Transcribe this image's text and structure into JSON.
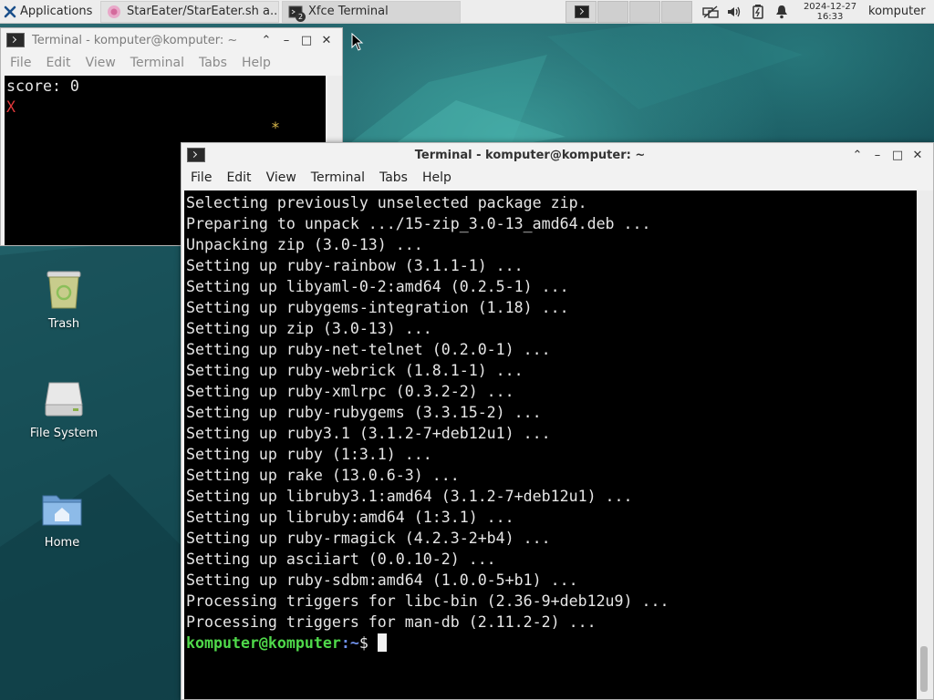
{
  "panel": {
    "applications_label": "Applications",
    "tasks": [
      {
        "label": "StarEater/StarEater.sh a..."
      },
      {
        "label": "Xfce Terminal",
        "badge": "2"
      }
    ],
    "clock_date": "2024-12-27",
    "clock_time": "16:33",
    "user": "komputer"
  },
  "window_back": {
    "title": "Terminal - komputer@komputer: ~",
    "menu": [
      "File",
      "Edit",
      "View",
      "Terminal",
      "Tabs",
      "Help"
    ],
    "score_line": "score: 0",
    "player_char": "X",
    "star_char": "*"
  },
  "window_front": {
    "title": "Terminal - komputer@komputer: ~",
    "menu": [
      "File",
      "Edit",
      "View",
      "Terminal",
      "Tabs",
      "Help"
    ],
    "output_lines": [
      "Selecting previously unselected package zip.",
      "Preparing to unpack .../15-zip_3.0-13_amd64.deb ...",
      "Unpacking zip (3.0-13) ...",
      "Setting up ruby-rainbow (3.1.1-1) ...",
      "Setting up libyaml-0-2:amd64 (0.2.5-1) ...",
      "Setting up rubygems-integration (1.18) ...",
      "Setting up zip (3.0-13) ...",
      "Setting up ruby-net-telnet (0.2.0-1) ...",
      "Setting up ruby-webrick (1.8.1-1) ...",
      "Setting up ruby-xmlrpc (0.3.2-2) ...",
      "Setting up ruby-rubygems (3.3.15-2) ...",
      "Setting up ruby3.1 (3.1.2-7+deb12u1) ...",
      "Setting up ruby (1:3.1) ...",
      "Setting up rake (13.0.6-3) ...",
      "Setting up libruby3.1:amd64 (3.1.2-7+deb12u1) ...",
      "Setting up libruby:amd64 (1:3.1) ...",
      "Setting up ruby-rmagick (4.2.3-2+b4) ...",
      "Setting up asciiart (0.0.10-2) ...",
      "Setting up ruby-sdbm:amd64 (1.0.0-5+b1) ...",
      "Processing triggers for libc-bin (2.36-9+deb12u9) ...",
      "Processing triggers for man-db (2.11.2-2) ..."
    ],
    "prompt_user": "komputer@komputer",
    "prompt_path": ":~",
    "prompt_symbol": "$ "
  },
  "desktop_icons": [
    {
      "label": "Trash",
      "icon": "trash-icon"
    },
    {
      "label": "File System",
      "icon": "drive-icon"
    },
    {
      "label": "Home",
      "icon": "home-folder-icon"
    }
  ],
  "colors": {
    "prompt_green": "#4fd84a",
    "path_blue": "#6f8fe8",
    "player_red": "#e0383a",
    "star_yellow": "#d8b74a",
    "terminal_bg": "#000000"
  }
}
